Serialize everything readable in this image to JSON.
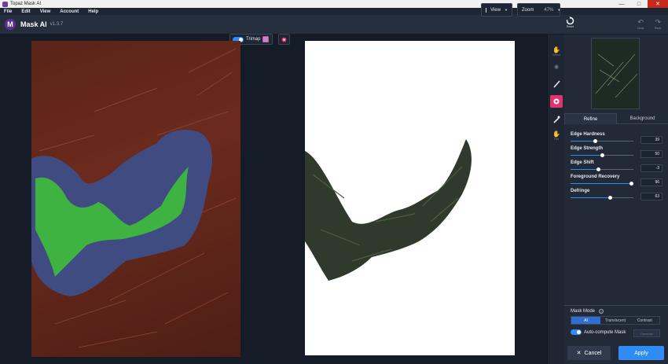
{
  "window": {
    "title": "Topaz Mask AI"
  },
  "menu": [
    "File",
    "Edit",
    "View",
    "Account",
    "Help"
  ],
  "header": {
    "logo_letter": "M",
    "app_name": "Mask AI",
    "version": "v1.3.7",
    "view_label": "View",
    "zoom_label": "Zoom",
    "zoom_value": "47%",
    "reset_label": "Reset",
    "undo_label": "Undo",
    "redo_label": "Redo"
  },
  "canvas": {
    "trimap_label": "Trimap"
  },
  "tools": {
    "select": "Select",
    "pan": "Pan"
  },
  "panel": {
    "tabs": [
      "Refine",
      "Background"
    ],
    "sliders": [
      {
        "label": "Edge Hardness",
        "value": 39,
        "pct": 0.39
      },
      {
        "label": "Edge Strength",
        "value": 50,
        "pct": 0.5
      },
      {
        "label": "Edge Shift",
        "value": -3,
        "pct": 0.44
      },
      {
        "label": "Foreground Recovery",
        "value": 96,
        "pct": 0.96
      },
      {
        "label": "Defringe",
        "value": 63,
        "pct": 0.63
      }
    ],
    "mask_mode_label": "Mask Mode",
    "help_glyph": "?",
    "mask_modes": [
      "AI",
      "Translucent",
      "Contrast"
    ],
    "auto_compute_label": "Auto-compute Mask",
    "generate_label": "Generate",
    "cancel_label": "Cancel",
    "apply_label": "Apply"
  }
}
